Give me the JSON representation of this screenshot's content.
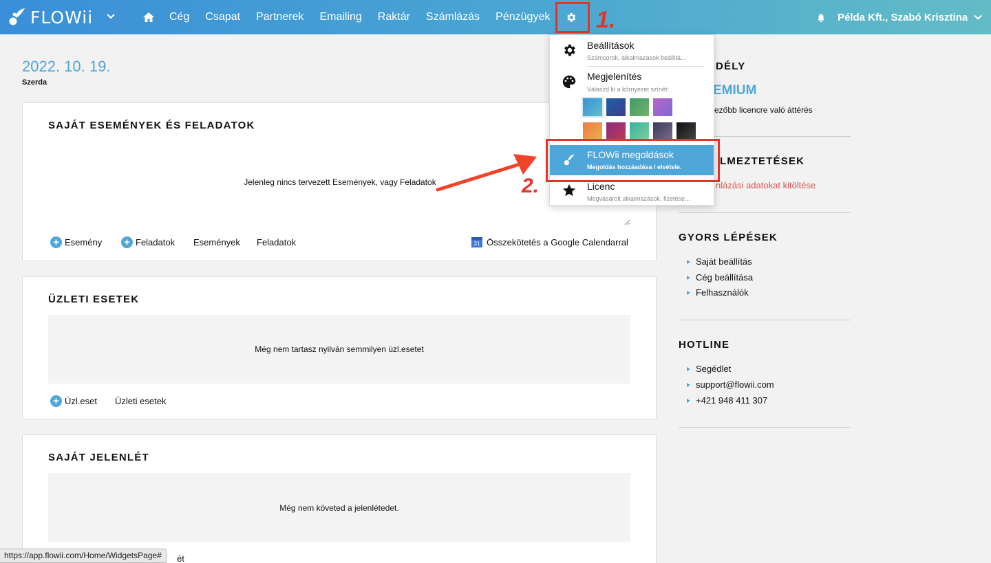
{
  "brand": {
    "logo_text": "FLOWii"
  },
  "nav": {
    "items": [
      "Cég",
      "Csapat",
      "Partnerek",
      "Emailing",
      "Raktár",
      "Számlázás",
      "Pénzügyek"
    ],
    "user": "Példa Kft., Szabó Krisztina"
  },
  "annotations": {
    "step1": "1.",
    "step2": "2."
  },
  "date": {
    "value": "2022. 10. 19.",
    "weekday": "Szerda"
  },
  "cards": {
    "events": {
      "title": "SAJÁT ESEMÉNYEK ÉS FELADATOK",
      "empty": "Jelenleg nincs tervezett Események, vagy Feladatok",
      "actions": [
        "Esemény",
        "Feladatok",
        "Események",
        "Feladatok"
      ],
      "calendar_link": "Összekötetés a Google Calendarral",
      "calendar_icon_text": "31"
    },
    "business": {
      "title": "ÜZLETI ESETEK",
      "empty": "Még nem tartasz nyilván semmilyen üzl.esetet",
      "actions": [
        "Üzl.eset",
        "Üzleti esetek"
      ]
    },
    "attendance": {
      "title": "SAJÁT JELENLÉT",
      "empty": "Még nem követed a jelenlétedet.",
      "action_partial": "ét"
    }
  },
  "sidebar": {
    "license_heading": "DÉLY",
    "license_plan": "EMIUM",
    "license_upgrade": "ezőbb licencre való áttérés",
    "warnings_heading": "LMEZTETÉSEK",
    "warning_link": "nlázási adatokat kitöltése",
    "quick_heading": "GYORS LÉPÉSEK",
    "quick_links": [
      "Saját beállítás",
      "Cég beállítása",
      "Felhasználók"
    ],
    "hotline_heading": "HOTLINE",
    "hotline_links": [
      "Segédlet",
      "support@flowii.com",
      "+421 948 411 307"
    ]
  },
  "dropdown": {
    "settings": {
      "title": "Beállítások",
      "sub": "Számsorok, alkalmazások beállítá..."
    },
    "display": {
      "title": "Megjelenítés",
      "sub": "Válaszd ki a környezet színét:"
    },
    "solutions": {
      "title": "FLOWii megoldások",
      "sub": "Megoldás hozzáadása / elvétele."
    },
    "license": {
      "title": "Licenc",
      "sub": "Megvásárolt alkalmazások, fizetése..."
    },
    "swatch_colors": [
      [
        "#3b8fd8",
        "#5fc0c8"
      ],
      [
        "#1f5ea8",
        "#3a3f8e"
      ],
      [
        "#3f9a6a",
        "#76b26a"
      ],
      [
        "#b866c8",
        "#7c6ad8"
      ],
      [
        "#f07a48",
        "#e8b04a"
      ],
      [
        "#8a2a7a",
        "#c03a5a"
      ],
      [
        "#3ab0a0",
        "#7ad0a0"
      ],
      [
        "#3a3a5a",
        "#7a6a8a"
      ],
      [
        "#111111",
        "#444444"
      ]
    ]
  },
  "status_bar": {
    "url": "https://app.flowii.com/Home/WidgetsPage#"
  }
}
